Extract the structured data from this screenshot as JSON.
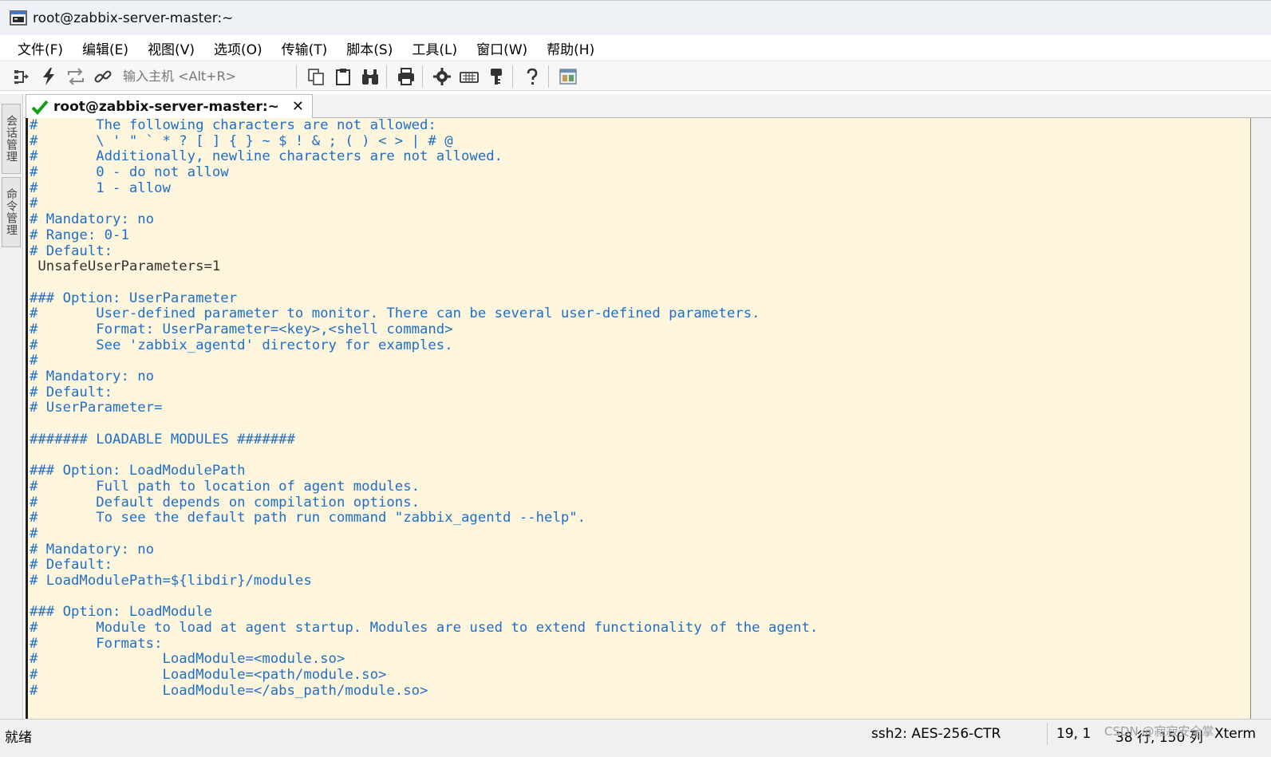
{
  "window": {
    "title": "root@zabbix-server-master:~"
  },
  "menu": [
    "文件(F)",
    "编辑(E)",
    "视图(V)",
    "选项(O)",
    "传输(T)",
    "脚本(S)",
    "工具(L)",
    "窗口(W)",
    "帮助(H)"
  ],
  "toolbar": {
    "host_placeholder": "输入主机 <Alt+R>"
  },
  "side_tabs": [
    "会话管理",
    "命令管理"
  ],
  "tab": {
    "label": "root@zabbix-server-master:~",
    "close": "✕"
  },
  "terminal": {
    "lines": [
      "#       The following characters are not allowed:",
      "#       \\ ' \" ` * ? [ ] { } ~ $ ! & ; ( ) < > | # @",
      "#       Additionally, newline characters are not allowed.",
      "#       0 - do not allow",
      "#       1 - allow",
      "#",
      "# Mandatory: no",
      "# Range: 0-1",
      "# Default:",
      " UnsafeUserParameters=1",
      "",
      "### Option: UserParameter",
      "#       User-defined parameter to monitor. There can be several user-defined parameters.",
      "#       Format: UserParameter=<key>,<shell command>",
      "#       See 'zabbix_agentd' directory for examples.",
      "#",
      "# Mandatory: no",
      "# Default:",
      "# UserParameter=",
      "",
      "####### LOADABLE MODULES #######",
      "",
      "### Option: LoadModulePath",
      "#       Full path to location of agent modules.",
      "#       Default depends on compilation options.",
      "#       To see the default path run command \"zabbix_agentd --help\".",
      "#",
      "# Mandatory: no",
      "# Default:",
      "# LoadModulePath=${libdir}/modules",
      "",
      "### Option: LoadModule",
      "#       Module to load at agent startup. Modules are used to extend functionality of the agent.",
      "#       Formats:",
      "#               LoadModule=<module.so>",
      "#               LoadModule=<path/module.so>",
      "#               LoadModule=</abs_path/module.so>"
    ],
    "dark_line_index": 9,
    "background": "#fdf5dc",
    "text_color": "#1f6fc9"
  },
  "status": {
    "left": "就绪",
    "cipher": "ssh2: AES-256-CTR",
    "cursor": "19,   1",
    "size": "38 行, 150 列",
    "term": "Xterm",
    "watermark": "CSDN @寂寂安全掌"
  },
  "icons": [
    "new-session-icon",
    "quick-connect-icon",
    "reconnect-icon",
    "link-icon",
    "copy-icon",
    "paste-icon",
    "find-icon",
    "print-icon",
    "settings-icon",
    "keymap-icon",
    "key-icon",
    "help-icon",
    "sftp-icon",
    "terminal-app-icon",
    "checkmark-icon"
  ]
}
